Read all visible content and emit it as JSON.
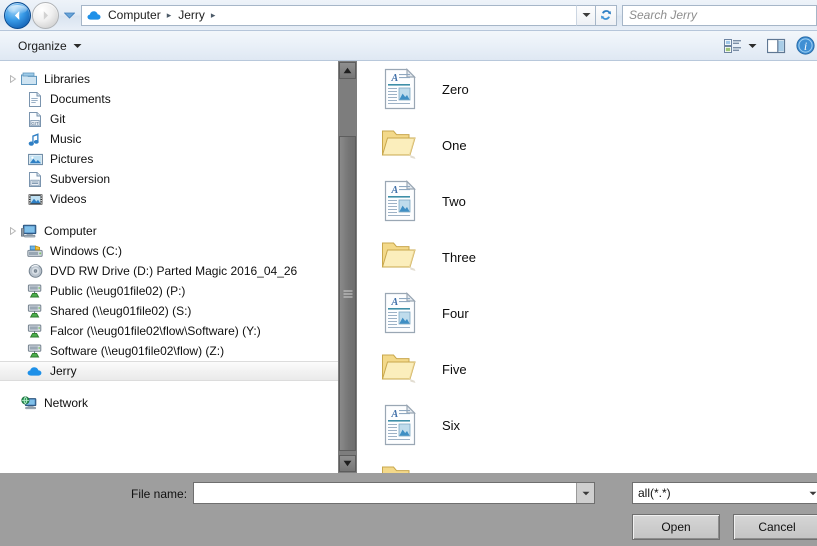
{
  "titlebar": {
    "back_icon": "back-arrow-icon",
    "forward_icon": "forward-arrow-icon",
    "history_icon": "chevron-down-icon",
    "address_icon": "cloud-icon",
    "breadcrumbs": [
      "Computer",
      "Jerry"
    ],
    "breadcrumb_separator": "▸",
    "address_dropdown_icon": "chevron-down-icon",
    "refresh_icon": "refresh-icon",
    "search_placeholder": "Search Jerry"
  },
  "toolbar": {
    "organize_label": "Organize",
    "organize_caret": "▼",
    "views_icon": "change-view-icon",
    "views_caret": "▼",
    "preview_icon": "preview-pane-icon",
    "help_icon": "help-icon"
  },
  "sidebar": {
    "groups": [
      {
        "name": "Libraries",
        "icon": "libraries-folder-icon",
        "items": [
          {
            "label": "Documents",
            "icon": "documents-library-icon"
          },
          {
            "label": "Git",
            "icon": "git-library-icon"
          },
          {
            "label": "Music",
            "icon": "music-note-icon"
          },
          {
            "label": "Pictures",
            "icon": "pictures-library-icon"
          },
          {
            "label": "Subversion",
            "icon": "subversion-library-icon"
          },
          {
            "label": "Videos",
            "icon": "videos-library-icon"
          }
        ]
      },
      {
        "name": "Computer",
        "icon": "computer-icon",
        "items": [
          {
            "label": "Windows (C:)",
            "icon": "hard-drive-icon"
          },
          {
            "label": "DVD RW Drive (D:) Parted Magic 2016_04_26",
            "icon": "optical-drive-icon"
          },
          {
            "label": "Public (\\\\eug01file02) (P:)",
            "icon": "network-drive-icon"
          },
          {
            "label": "Shared (\\\\eug01file02) (S:)",
            "icon": "network-drive-icon"
          },
          {
            "label": "Falcor (\\\\eug01file02\\flow\\Software) (Y:)",
            "icon": "network-drive-icon"
          },
          {
            "label": "Software (\\\\eug01file02\\flow) (Z:)",
            "icon": "network-drive-icon"
          },
          {
            "label": "Jerry",
            "icon": "cloud-icon",
            "selected": true
          }
        ]
      },
      {
        "name": "Network",
        "icon": "network-icon",
        "items": []
      }
    ],
    "scrollbar": {
      "up_arrow_icon": "scroll-up-arrow-icon",
      "down_arrow_icon": "scroll-down-arrow-icon"
    }
  },
  "filelist": {
    "items": [
      {
        "name": "Zero",
        "icon": "document-icon"
      },
      {
        "name": "One",
        "icon": "folder-icon"
      },
      {
        "name": "Two",
        "icon": "document-icon"
      },
      {
        "name": "Three",
        "icon": "folder-icon"
      },
      {
        "name": "Four",
        "icon": "document-icon"
      },
      {
        "name": "Five",
        "icon": "folder-icon"
      },
      {
        "name": "Six",
        "icon": "document-icon"
      },
      {
        "name": "",
        "icon": "folder-icon"
      }
    ]
  },
  "footer": {
    "filename_label": "File name:",
    "filename_value": "",
    "filename_dropdown_icon": "chevron-down-icon",
    "filter_value": "all(*.*)",
    "filter_dropdown_icon": "chevron-down-icon",
    "open_label": "Open",
    "cancel_label": "Cancel"
  },
  "colors": {
    "chrome_top": "#e4ecf5",
    "panel_gray": "#9e9e9e",
    "pane_white": "#ffffff",
    "folder_yellow": "#f6d87c",
    "accent_blue": "#1e90e8"
  }
}
